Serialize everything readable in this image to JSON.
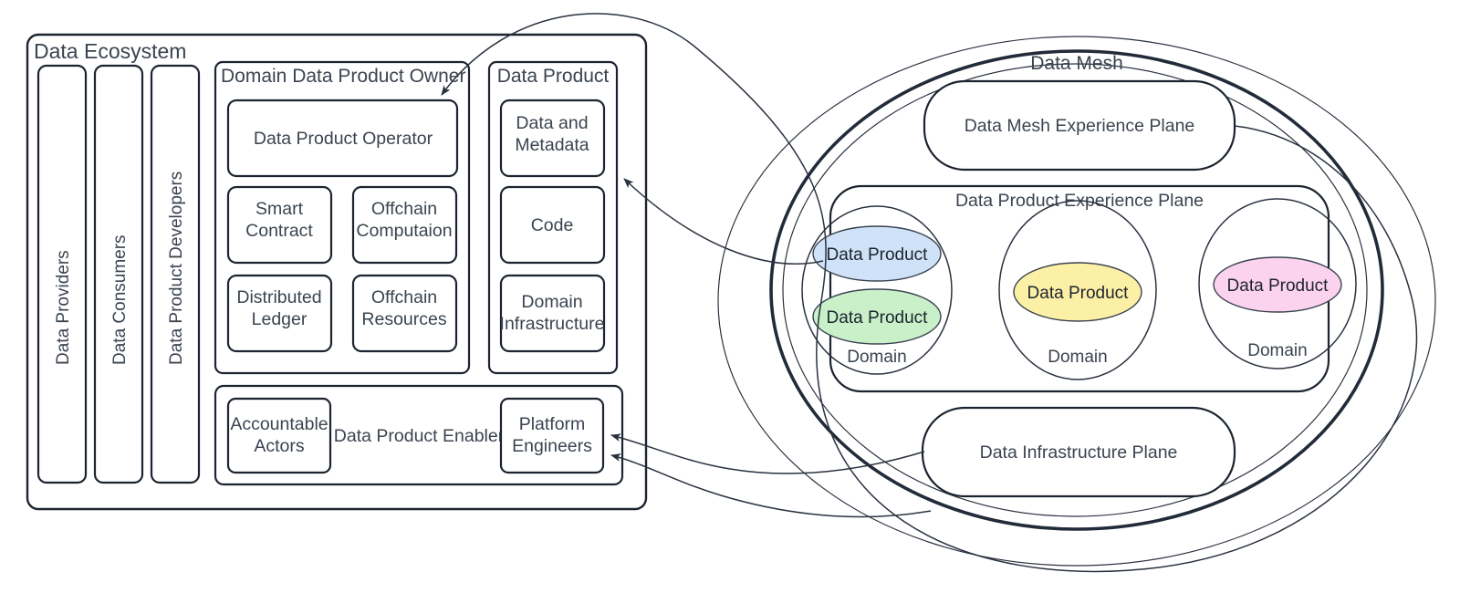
{
  "diagram": {
    "title_visible": false,
    "stroke_color": "#1c2430",
    "text_color": "#3b4450"
  },
  "ecosystem": {
    "label": "Data Ecosystem",
    "lanes": [
      {
        "label": "Data Providers"
      },
      {
        "label": "Data Consumers"
      },
      {
        "label": "Data Product Developers"
      }
    ],
    "owner_group": {
      "label": "Domain Data Product Owner",
      "operator": {
        "label": "Data Product Operator"
      },
      "cells": [
        {
          "label": "Smart Contract",
          "lines": [
            "Smart",
            "Contract"
          ]
        },
        {
          "label": "Offchain Computaion",
          "lines": [
            "Offchain",
            "Computaion"
          ]
        },
        {
          "label": "Distributed Ledger",
          "lines": [
            "Distributed",
            "Ledger"
          ]
        },
        {
          "label": "Offchain Resources",
          "lines": [
            "Offchain",
            "Resources"
          ]
        }
      ]
    },
    "data_product_group": {
      "label": "Data Product",
      "cells": [
        {
          "label": "Data and Metadata",
          "lines": [
            "Data and",
            "Metadata"
          ]
        },
        {
          "label": "Code",
          "lines": [
            "Code"
          ]
        },
        {
          "label": "Domain Infrastructure",
          "lines": [
            "Domain",
            "Infrastructure"
          ]
        }
      ]
    },
    "enabler_group": {
      "label": "Data Product Enabler",
      "left_cell": {
        "label": "Accountable Actors",
        "lines": [
          "Accountable",
          "Actors"
        ]
      },
      "right_cell": {
        "label": "Platform Engineers",
        "lines": [
          "Platform",
          "Engineers"
        ]
      }
    }
  },
  "mesh": {
    "label": "Data Mesh",
    "experience_plane": {
      "label": "Data Mesh Experience Plane"
    },
    "product_experience_plane": {
      "label": "Data Product Experience Plane"
    },
    "infrastructure_plane": {
      "label": "Data Infrastructure Plane"
    },
    "domains": [
      {
        "label": "Domain",
        "products": [
          {
            "label": "Data Product",
            "color": "#cfe2f8"
          },
          {
            "label": "Data Product",
            "color": "#c9f0c9"
          }
        ]
      },
      {
        "label": "Domain",
        "products": [
          {
            "label": "Data Product",
            "color": "#fcf0a6"
          }
        ]
      },
      {
        "label": "Domain",
        "products": [
          {
            "label": "Data Product",
            "color": "#fbd3ee"
          }
        ]
      }
    ]
  },
  "connectors": [
    {
      "name": "mesh-to-data-product-operator",
      "direction": "left"
    },
    {
      "name": "data-product-to-data-product-group",
      "direction": "left"
    },
    {
      "name": "infrastructure-plane-to-platform-engineers-a",
      "direction": "left"
    },
    {
      "name": "infrastructure-plane-to-platform-engineers-b",
      "direction": "left"
    }
  ]
}
